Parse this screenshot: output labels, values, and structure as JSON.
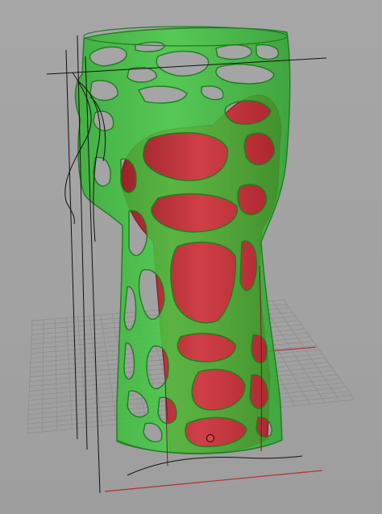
{
  "viewport": {
    "view_name": "",
    "background_color": "#a3a3a3",
    "grid_color": "#8c8c8c",
    "x_axis_color": "#b03030",
    "model_green": "#39c93a",
    "model_red": "#c4353c",
    "curve_color": "#111111",
    "control_point_icon": "circle-control-point-icon"
  }
}
